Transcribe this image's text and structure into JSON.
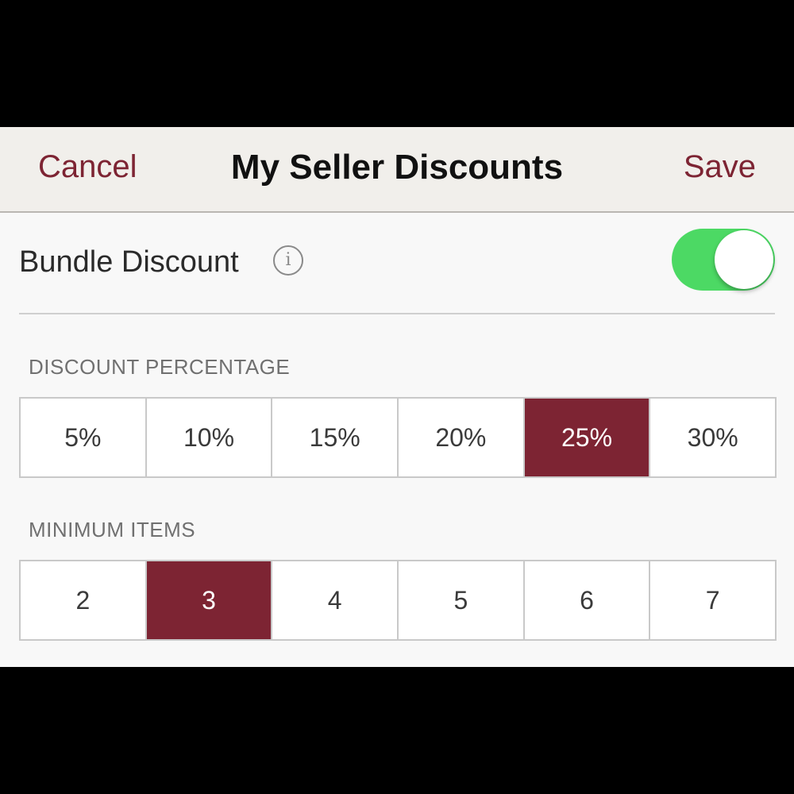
{
  "navbar": {
    "cancel_label": "Cancel",
    "title": "My Seller Discounts",
    "save_label": "Save"
  },
  "bundle": {
    "label": "Bundle Discount",
    "info_icon": "info-icon",
    "info_glyph": "i",
    "toggle_on": true
  },
  "discount_percentage": {
    "label": "DISCOUNT PERCENTAGE",
    "options": [
      "5%",
      "10%",
      "15%",
      "20%",
      "25%",
      "30%"
    ],
    "selected": "25%"
  },
  "minimum_items": {
    "label": "MINIMUM ITEMS",
    "options": [
      "2",
      "3",
      "4",
      "5",
      "6",
      "7"
    ],
    "selected": "3"
  },
  "colors": {
    "accent": "#7d2433",
    "toggle_on": "#4cd964",
    "navbar_bg": "#f1efeb"
  }
}
